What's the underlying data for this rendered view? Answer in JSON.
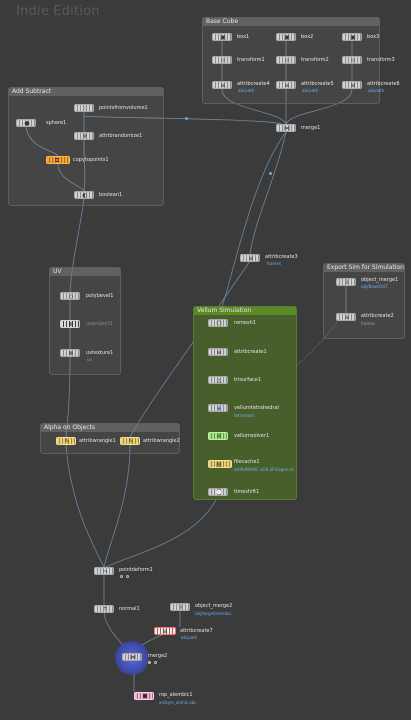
{
  "edition_label": "Indie Edition",
  "network_boxes": {
    "base_cube": "Base Cube",
    "add_subtract": "Add Subtract",
    "uv": "UV",
    "vellum": "Vellum Simulation",
    "export_sim": "Export Sim for Simulation",
    "alpha_objects": "Alpha on Objects"
  },
  "nodes": {
    "box1": "box1",
    "box2": "box2",
    "box3": "box3",
    "transform1": "transform1",
    "transform2": "transform2",
    "transform3": "transform3",
    "attribcreate4": "attribcreate4",
    "attribcreate5": "attribcreate5",
    "attribcreate6": "attribcreate6",
    "attribcreate4_sub": "abcpath",
    "attribcreate5_sub": "abcpath",
    "attribcreate6_sub": "abcpath",
    "merge1": "merge1",
    "sphere1": "sphere1",
    "pointsfromvolume1": "pointsfromvolume1",
    "attribrandomize1": "attribrandomize1",
    "copytopoints1": "copytopoints1",
    "boolean1": "boolean1",
    "attribcreate3": "attribcreate3",
    "attribcreate3_sub": "frames",
    "polybevel1": "polybevel1",
    "uvproject1": "uvproject1",
    "uvtexture1": "uvtexture1",
    "uvtexture1_sub": "uv",
    "remesh1": "remesh1",
    "attribcreate1": "attribcreate1",
    "trisurface1": "trisurface1",
    "vellumtetrahedral": "vellumtetrahedral",
    "vellumtetrahedral_sub": "tetramesh",
    "vellumsolver1": "vellumsolver1",
    "filecache1": "filecache1",
    "filecache1_sub": "$HIP/ANIMIC.$OS.$F4.bgeo.sc",
    "timeshift1": "timeshift1",
    "object_merge1": "object_merge1",
    "object_merge1_sub": "obj/Bowl/OUT",
    "attribcreate2": "attribcreate2",
    "attribcreate2_sub": "frames",
    "attribwrangle1": "attribwrangle1",
    "attribwrangle2": "attribwrangle2",
    "pointdeform1": "pointdeform1",
    "normal1": "normal1",
    "object_merge2": "object_merge2",
    "object_merge2_sub": "obj/target/alembic",
    "attribcreate7": "attribcreate7",
    "attribcreate7_sub": "abcpath",
    "merge2": "merge2",
    "rop_alembic1": "rop_alembic1",
    "rop_alembic1_sub": "anibym_anmls.abc"
  },
  "icons": {
    "box": "▣",
    "transform": "⊹",
    "attribcreate": "≡",
    "merge": "⋈",
    "sphere": "●",
    "points": "∴",
    "randomize": "※",
    "copy": "⧉",
    "boolean": "◐",
    "bevel": "◇",
    "uv": "⊗",
    "remesh": "⬡",
    "trisurface": "△",
    "tetra": "◈",
    "solver": "✲",
    "filecache": "▤",
    "timeshift": "⌚",
    "object_merge": "⇩",
    "wrangle": "✎",
    "pointdeform": "⤳",
    "normal": "↑",
    "rop": "⬢"
  },
  "colors": {
    "background": "#3b3b3b",
    "wire": "#6f8fb0",
    "vellum_box": "#485f2b",
    "sub_label": "#6aaee8",
    "orange_node": "#f2a33a",
    "green_node": "#a8e28a",
    "merge_ring": "#4a56c4"
  }
}
